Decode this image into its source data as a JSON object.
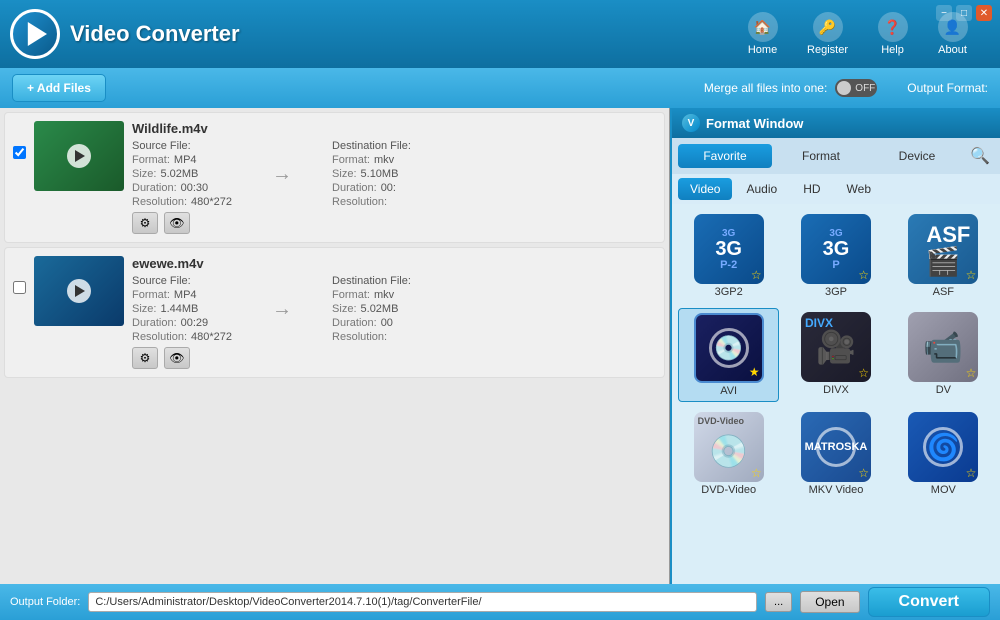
{
  "app": {
    "title": "Video Converter",
    "logo_letter": "V"
  },
  "nav": {
    "buttons": [
      {
        "id": "home",
        "label": "Home",
        "icon": "🏠"
      },
      {
        "id": "register",
        "label": "Register",
        "icon": "🔑"
      },
      {
        "id": "help",
        "label": "Help",
        "icon": "❓"
      },
      {
        "id": "about",
        "label": "About",
        "icon": "👤"
      }
    ]
  },
  "win_controls": {
    "minimize": "−",
    "restore": "□",
    "close": "✕"
  },
  "toolbar": {
    "add_files_label": "+ Add Files",
    "merge_label": "Merge all files into one:",
    "toggle_state": "OFF",
    "output_format_label": "Output Format:"
  },
  "files": [
    {
      "name": "Wildlife.m4v",
      "thumb_class": "thumb-wildlife",
      "source": {
        "label": "Source File:",
        "format_label": "Format:",
        "format_val": "MP4",
        "size_label": "Size:",
        "size_val": "5.02MB",
        "duration_label": "Duration:",
        "duration_val": "00:30",
        "resolution_label": "Resolution:",
        "resolution_val": "480*272"
      },
      "dest": {
        "label": "Destination File:",
        "format_label": "Format:",
        "format_val": "mkv",
        "size_label": "Size:",
        "size_val": "5.10MB",
        "duration_label": "Duration:",
        "duration_val": "00:",
        "resolution_label": "Resolution:",
        "resolution_val": ""
      }
    },
    {
      "name": "ewewe.m4v",
      "thumb_class": "thumb-ewewe",
      "source": {
        "label": "Source File:",
        "format_label": "Format:",
        "format_val": "MP4",
        "size_label": "Size:",
        "size_val": "1.44MB",
        "duration_label": "Duration:",
        "duration_val": "00:29",
        "resolution_label": "Resolution:",
        "resolution_val": "480*272"
      },
      "dest": {
        "label": "Destination File:",
        "format_label": "Format:",
        "format_val": "mkv",
        "size_label": "Size:",
        "size_val": "5.02MB",
        "duration_label": "Duration:",
        "duration_val": "00",
        "resolution_label": "Resolution:",
        "resolution_val": ""
      }
    }
  ],
  "format_window": {
    "title": "Format Window",
    "tabs": [
      "Favorite",
      "Format",
      "Device"
    ],
    "active_tab": "Favorite",
    "subtabs": [
      "Video",
      "Audio",
      "HD",
      "Web"
    ],
    "active_subtab": "Video",
    "formats": [
      {
        "id": "3gp2",
        "label": "3GP2",
        "icon_class": "icon-3gp2",
        "type": "3g"
      },
      {
        "id": "3gp",
        "label": "3GP",
        "icon_class": "icon-3gp",
        "type": "3g"
      },
      {
        "id": "asf",
        "label": "ASF",
        "icon_class": "icon-asf",
        "type": "asf"
      },
      {
        "id": "avi",
        "label": "AVI",
        "icon_class": "icon-avi",
        "type": "avi",
        "selected": true
      },
      {
        "id": "divx",
        "label": "DIVX",
        "icon_class": "icon-divx",
        "type": "divx"
      },
      {
        "id": "dv",
        "label": "DV",
        "icon_class": "icon-dv",
        "type": "dv"
      },
      {
        "id": "dvd",
        "label": "DVD-Video",
        "icon_class": "icon-dvd",
        "type": "dvd"
      },
      {
        "id": "mkv",
        "label": "MKV Video",
        "icon_class": "icon-mkv",
        "type": "mkv"
      },
      {
        "id": "mov",
        "label": "MOV",
        "icon_class": "icon-mov",
        "type": "mov"
      }
    ]
  },
  "bottom": {
    "output_label": "Output Folder:",
    "output_path": "C:/Users/Administrator/Desktop/VideoConverter2014.7.10(1)/tag/ConverterFile/",
    "dots_label": "...",
    "open_label": "Open",
    "convert_label": "Convert"
  }
}
